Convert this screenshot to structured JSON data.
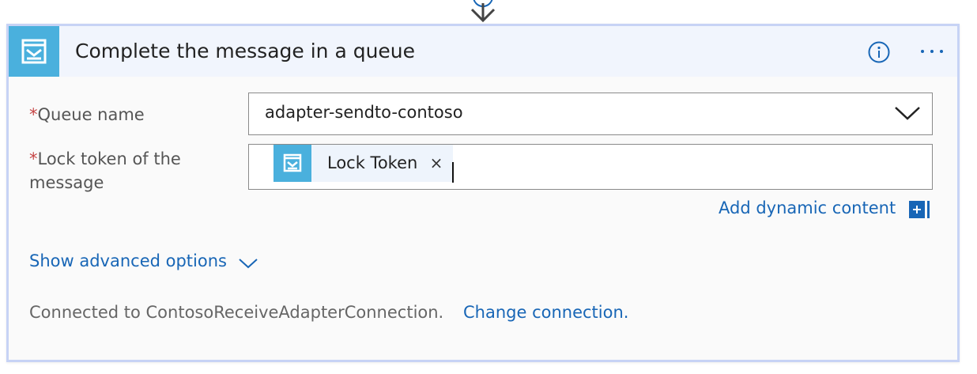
{
  "colors": {
    "accent": "#4ab0dd",
    "link": "#1866b6",
    "required": "#c64545",
    "card_border": "#c7d3f5",
    "header_bg": "#f1f5fd"
  },
  "connector": {
    "icon": "arrow-down-icon"
  },
  "header": {
    "icon": "service-bus-queue-icon",
    "title": "Complete the message in a queue",
    "info_icon": "info-icon",
    "more_icon": "more-options-icon"
  },
  "fields": {
    "queue_name": {
      "required_mark": "*",
      "label": "Queue name",
      "value": "adapter-sendto-contoso",
      "chevron_icon": "chevron-down-icon"
    },
    "lock_token": {
      "required_mark": "*",
      "label": "Lock token of the message",
      "token": {
        "icon": "service-bus-queue-icon",
        "label": "Lock Token",
        "remove_glyph": "×"
      }
    }
  },
  "dynamic_content": {
    "label": "Add dynamic content",
    "icon": "plus-icon"
  },
  "advanced": {
    "label": "Show advanced options",
    "icon": "chevron-down-icon"
  },
  "connection": {
    "text": "Connected to ContosoReceiveAdapterConnection.",
    "change_label": "Change connection."
  }
}
